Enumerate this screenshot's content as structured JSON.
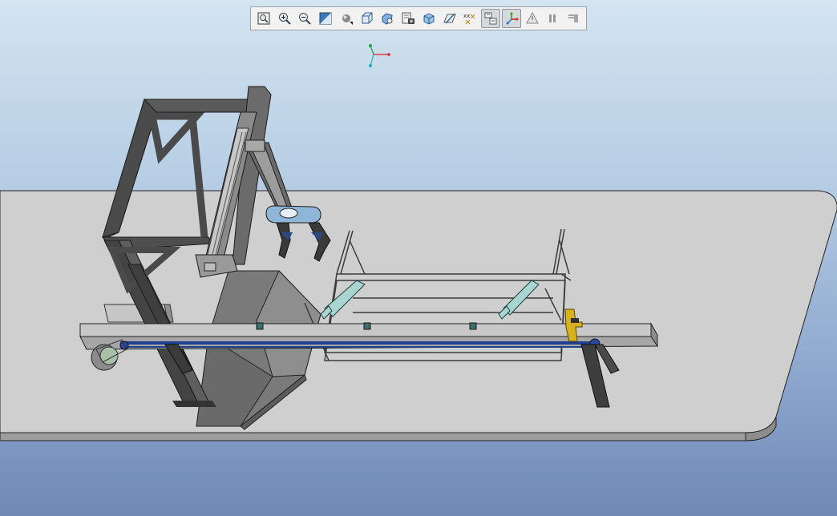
{
  "toolbar": {
    "buttons": [
      {
        "name": "refit-icon",
        "active": false
      },
      {
        "name": "zoom-in-icon",
        "active": false
      },
      {
        "name": "zoom-out-icon",
        "active": false
      },
      {
        "name": "repaint-icon",
        "active": false
      },
      {
        "name": "spin-center-icon",
        "active": false
      },
      {
        "name": "saved-views-icon",
        "active": false
      },
      {
        "name": "display-style-icon",
        "active": false
      },
      {
        "name": "view-manager-icon",
        "active": false
      },
      {
        "name": "orient-view-icon",
        "active": false
      },
      {
        "name": "datum-planes-icon",
        "active": false
      },
      {
        "name": "datum-points-icon",
        "active": false
      },
      {
        "name": "csys-display-icon",
        "active": true
      },
      {
        "name": "axis-display-icon",
        "active": true
      },
      {
        "name": "annotation-display-icon",
        "active": false
      },
      {
        "name": "pause-icon",
        "active": false
      },
      {
        "name": "next-frame-icon",
        "active": false
      }
    ]
  },
  "colors": {
    "floor": "#d0d0d0",
    "frame": "#555555",
    "rail": "#b9b9b9",
    "belt": "#1f3f8f",
    "accent_yellow": "#d8b21d",
    "gripper_blue": "#8fb5d9"
  }
}
